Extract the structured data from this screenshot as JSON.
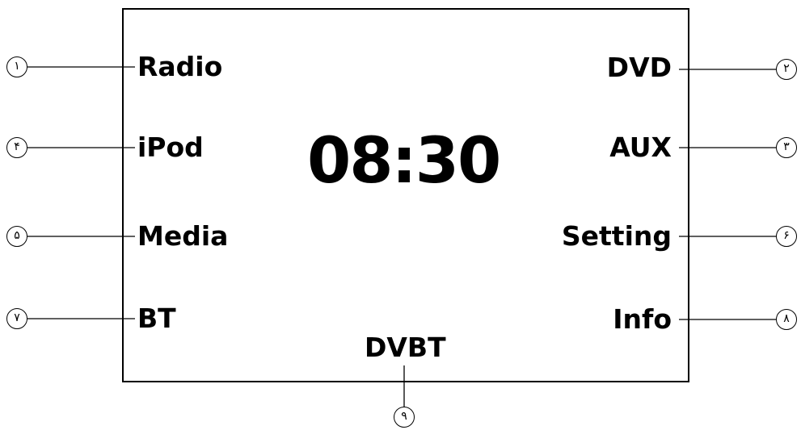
{
  "clock": {
    "time": "08:30"
  },
  "menu": {
    "radio": "Radio",
    "ipod": "iPod",
    "media": "Media",
    "bt": "BT",
    "dvd": "DVD",
    "aux": "AUX",
    "setting": "Setting",
    "info": "Info",
    "dvbt": "DVBT"
  },
  "callouts": {
    "n1": "١",
    "n2": "٢",
    "n3": "٣",
    "n4": "۴",
    "n5": "۵",
    "n6": "۶",
    "n7": "٧",
    "n8": "٨",
    "n9": "٩"
  }
}
